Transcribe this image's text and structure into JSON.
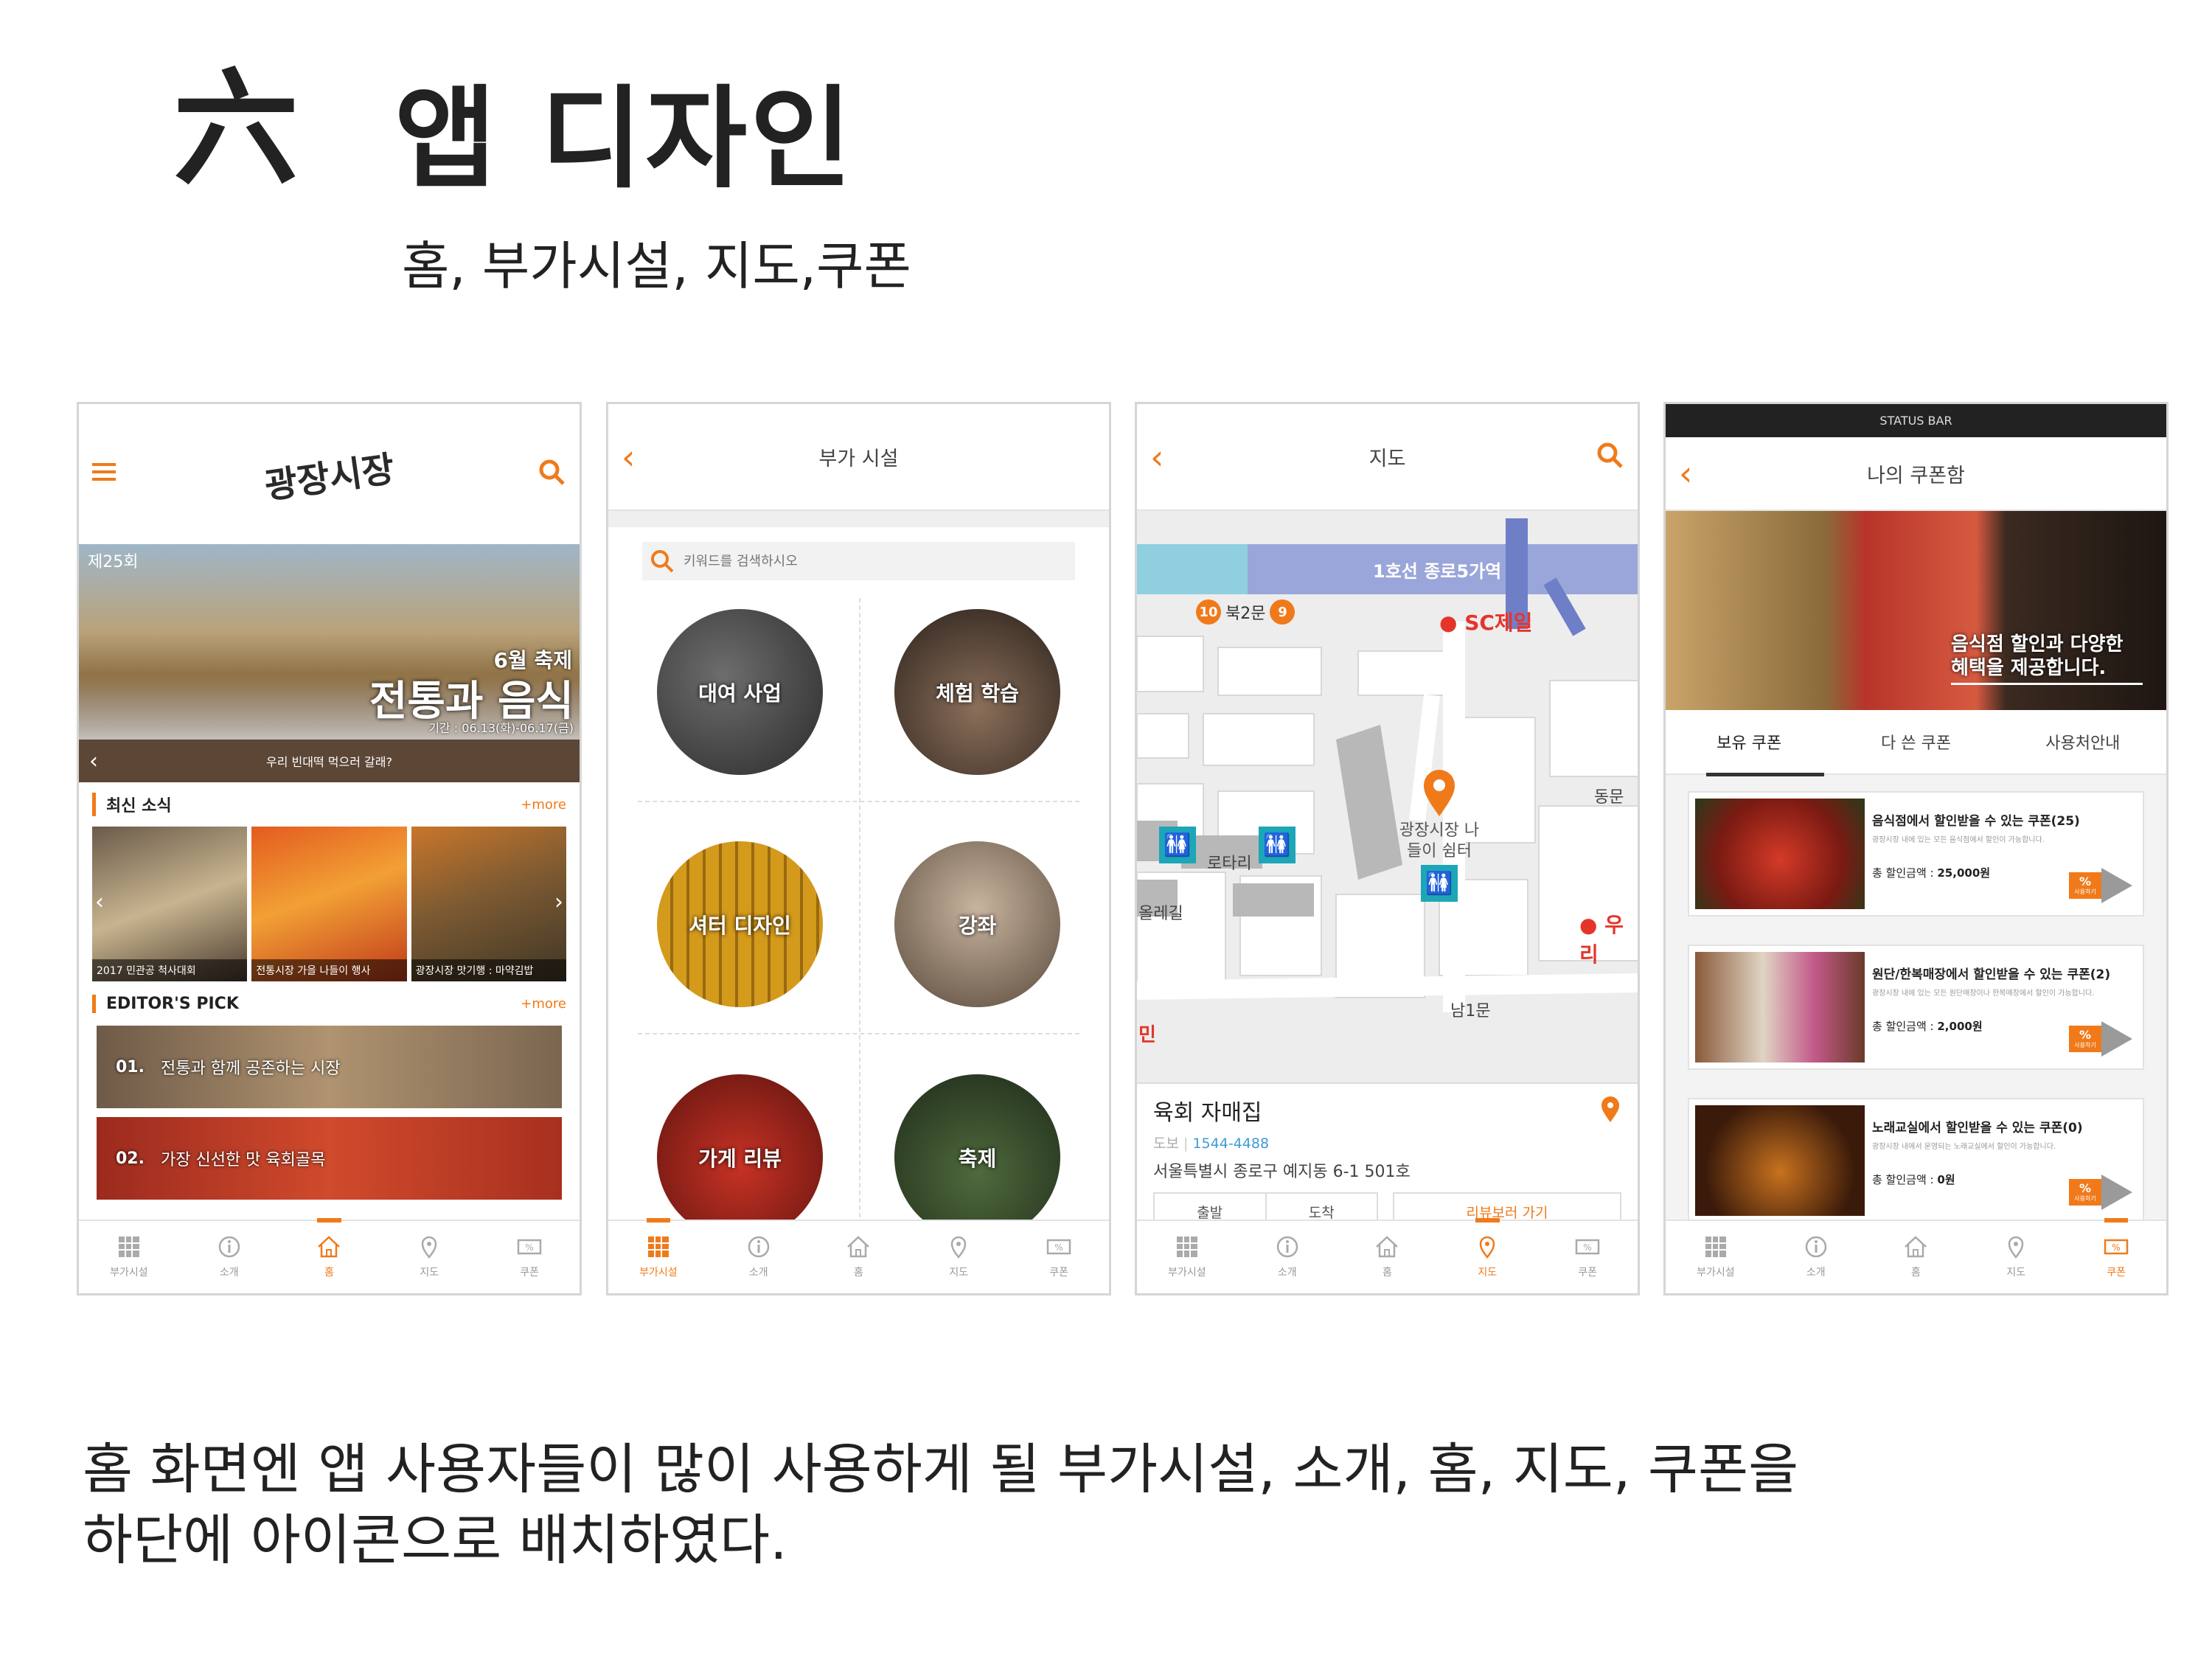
{
  "page": {
    "title_mark": "六",
    "title": "앱 디자인",
    "subtitle": "홈, 부가시설, 지도,쿠폰",
    "footer_line1": "홈 화면엔 앱 사용자들이 많이 사용하게 될 부가시설, 소개, 홈, 지도, 쿠폰을",
    "footer_line2": "하단에 아이콘으로 배치하였다."
  },
  "colors": {
    "accent": "#f07a1a",
    "subway": "#9aa6da",
    "subway_dark": "#6e7fc8"
  },
  "tabbar": {
    "items": [
      {
        "label": "부가시설",
        "icon": "grid-icon"
      },
      {
        "label": "소개",
        "icon": "info-icon"
      },
      {
        "label": "홈",
        "icon": "home-icon"
      },
      {
        "label": "지도",
        "icon": "map-pin-icon"
      },
      {
        "label": "쿠폰",
        "icon": "coupon-icon"
      }
    ]
  },
  "home": {
    "logo": "광장시장",
    "banner": {
      "edition": "제25회",
      "month_fest": "6월 축제",
      "headline": "전통과 음식",
      "period": "기간 : 06.13(화)-06.17(금)",
      "ticker": "우리 빈대떡 먹으러 갈래?"
    },
    "news": {
      "title": "최신 소식",
      "more": "+more",
      "items": [
        "2017 민관공 척사대회",
        "전통시장 가을 나들이 행사",
        "광장시장 맛기행 : 마약김밥"
      ]
    },
    "picks": {
      "title": "EDITOR'S PICK",
      "more": "+more",
      "items": [
        {
          "num": "01.",
          "text": "전통과 함께 공존하는 시장"
        },
        {
          "num": "02.",
          "text": "가장 신선한 맛 육회골목"
        }
      ]
    },
    "active_tab": "홈"
  },
  "facilities": {
    "title": "부가 시설",
    "search_placeholder": "키워드를 검색하시오",
    "items": [
      "대여 사업",
      "체험 학습",
      "셔터 디자인",
      "강좌",
      "가게 리뷰",
      "축제"
    ],
    "active_tab": "부가시설"
  },
  "map": {
    "title": "지도",
    "subway": "1호선 종로5가역",
    "exit": "북2문",
    "exit_left": "10",
    "exit_right": "9",
    "bank": "SC제일",
    "east_gate": "동문",
    "rotary": "로타리",
    "rest_area": "광장시장 나들이 쉼터",
    "woori": "우리",
    "south_gate": "남1문",
    "road": "올레길",
    "edge_label": "민",
    "place": {
      "name": "육회 자매집",
      "tag": "도보",
      "phone": "1544-4488",
      "address": "서울특별시 종로구 예지동 6-1 501호"
    },
    "buttons": {
      "depart": "출발",
      "arrive": "도착",
      "review": "리뷰보러 가기"
    },
    "active_tab": "지도"
  },
  "coupons": {
    "status_bar": "STATUS BAR",
    "title": "나의 쿠폰함",
    "banner": "음식점 할인과 다양한 혜택을 제공합니다.",
    "tabs": [
      "보유 쿠폰",
      "다 쓴 쿠폰",
      "사용처안내"
    ],
    "items": [
      {
        "title": "음식점에서 할인받을 수 있는 쿠폰(25)",
        "desc": "광장시장 내에 있는 모든 음식점에서 할인이 가능합니다.",
        "amount_label": "총 할인금액 :",
        "amount": "25,000원",
        "badge": "%",
        "badge_label": "사용하기"
      },
      {
        "title": "원단/한복매장에서 할인받을 수 있는 쿠폰(2)",
        "desc": "광장시장 내에 있는 모든 원단매장이나 한복매장에서 할인이 가능합니다.",
        "amount_label": "총 할인금액 :",
        "amount": "2,000원",
        "badge": "%",
        "badge_label": "사용하기"
      },
      {
        "title": "노래교실에서 할인받을 수 있는 쿠폰(0)",
        "desc": "광장시장 내에서 운영되는 노래교실에서 할인이 가능합니다.",
        "amount_label": "총 할인금액 :",
        "amount": "0원",
        "badge": "%",
        "badge_label": "사용하기"
      }
    ],
    "active_tab": "쿠폰"
  }
}
